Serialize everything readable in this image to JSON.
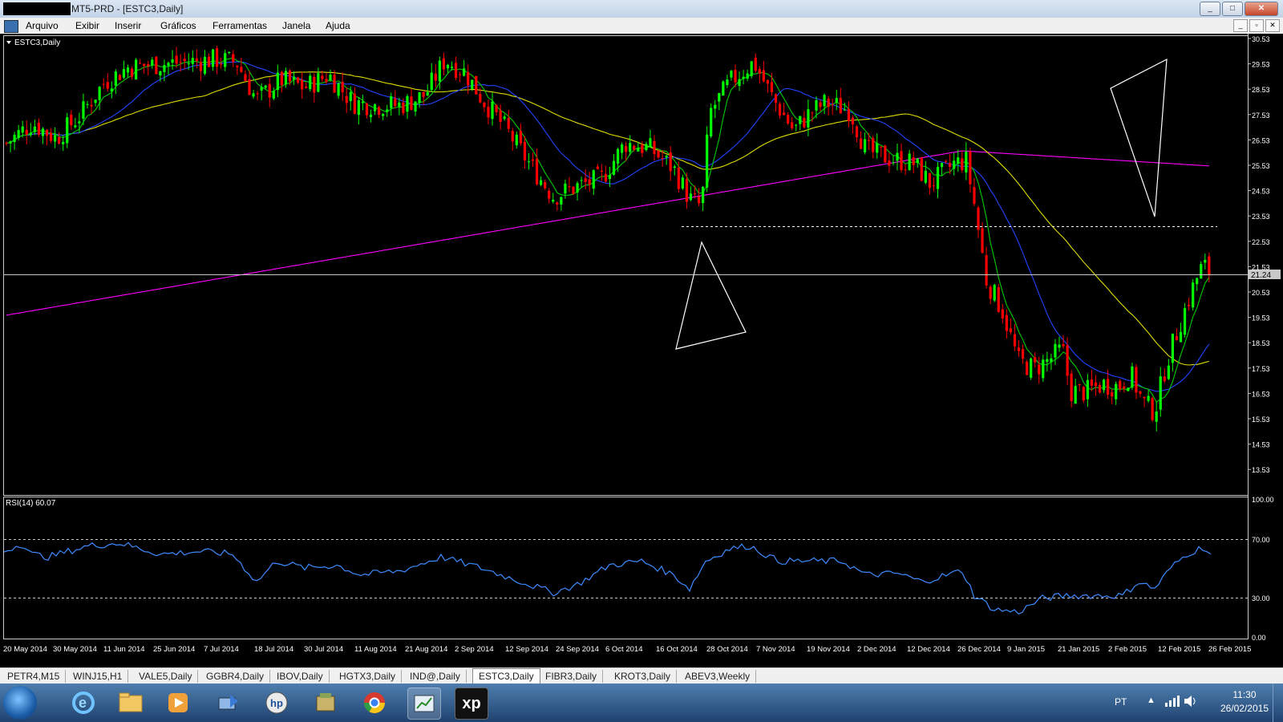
{
  "window": {
    "title": "MT5-PRD - [ESTC3,Daily]",
    "controls": {
      "minimize": "_",
      "maximize": "□",
      "close": "✕"
    }
  },
  "menu": {
    "items": [
      "Arquivo",
      "Exibir",
      "Inserir",
      "Gráficos",
      "Ferramentas",
      "Janela",
      "Ajuda"
    ],
    "mdi_controls": {
      "minimize": "_",
      "restore": "▫",
      "close": "✕"
    }
  },
  "chart": {
    "symbol_label": "ESTC3,Daily",
    "current_price": "21.24",
    "price_ticks": [
      "30.53",
      "29.53",
      "28.53",
      "27.53",
      "26.53",
      "25.53",
      "24.53",
      "23.53",
      "22.53",
      "21.53",
      "20.53",
      "19.53",
      "18.53",
      "17.53",
      "16.53",
      "15.53",
      "14.53",
      "13.53"
    ],
    "rsi_label": "RSI(14) 60.07",
    "rsi_ticks": [
      "100.00",
      "70.00",
      "30.00",
      "0.00"
    ],
    "date_ticks": [
      "20 May 2014",
      "30 May 2014",
      "11 Jun 2014",
      "25 Jun 2014",
      "7 Jul 2014",
      "18 Jul 2014",
      "30 Jul 2014",
      "11 Aug 2014",
      "21 Aug 2014",
      "2 Sep 2014",
      "12 Sep 2014",
      "24 Sep 2014",
      "6 Oct 2014",
      "16 Oct 2014",
      "28 Oct 2014",
      "7 Nov 2014",
      "19 Nov 2014",
      "2 Dec 2014",
      "12 Dec 2014",
      "26 Dec 2014",
      "9 Jan 2015",
      "21 Jan 2015",
      "2 Feb 2015",
      "12 Feb 2015",
      "26 Feb 2015"
    ],
    "colors": {
      "bull": "#00ff00",
      "bear": "#ff0000",
      "ma_fast": "#00cc00",
      "ma_mid": "#2244ff",
      "ma_slow": "#dddd00",
      "ma_long": "#ff00ff",
      "rsi": "#3d8bff"
    }
  },
  "tabs": {
    "items": [
      "PETR4,M15",
      "WINJ15,H1",
      "VALE5,Daily",
      "GGBR4,Daily",
      "IBOV,Daily",
      "HGTX3,Daily",
      "IND@,Daily",
      "ESTC3,Daily",
      "FIBR3,Daily",
      "KROT3,Daily",
      "ABEV3,Weekly"
    ],
    "active": "ESTC3,Daily"
  },
  "taskbar": {
    "apps": [
      "start-orb",
      "ie",
      "explorer",
      "media",
      "network",
      "hp",
      "archive",
      "chrome",
      "mt5",
      "xp"
    ],
    "xp_label": "xp",
    "language": "PT",
    "time": "11:30",
    "date": "26/02/2015"
  }
}
